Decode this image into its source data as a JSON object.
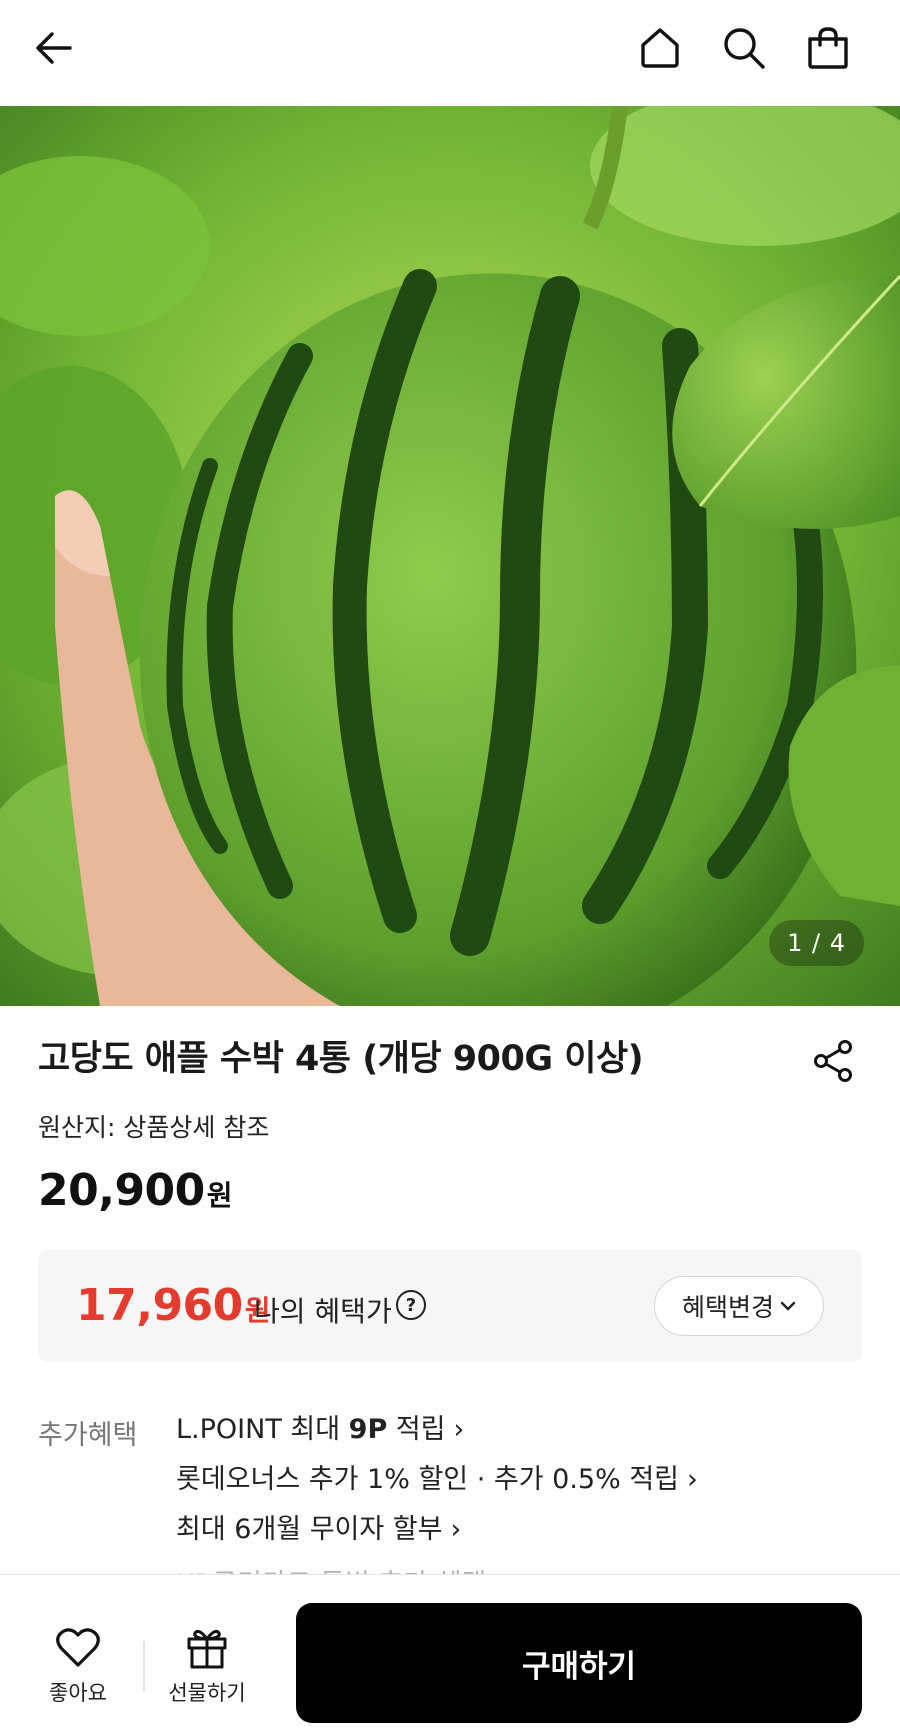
{
  "header": {
    "back_icon": "arrow-left-icon",
    "home_icon": "home-icon",
    "search_icon": "search-icon",
    "cart_icon": "shopping-bag-icon"
  },
  "gallery": {
    "pager": "1 / 4",
    "current": 1,
    "total": 4
  },
  "product": {
    "title": "고당도 애플 수박 4통 (개당 900G 이상)",
    "origin": "원산지: 상품상세 참조",
    "price": "20,900",
    "price_unit": "원"
  },
  "benefit": {
    "price": "17,960",
    "price_unit": "원",
    "label": "나의 혜택가",
    "help_glyph": "?",
    "change_button": "혜택변경",
    "price_color": "#e33b2e"
  },
  "extra": {
    "label": "추가혜택",
    "items": [
      {
        "prefix": "L.POINT 최대 ",
        "bold": "9P",
        "suffix": " 적립"
      },
      {
        "prefix": "롯데오너스 추가 1% 할인 · 추가 0.5% 적립",
        "bold": "",
        "suffix": ""
      },
      {
        "prefix": "최대 6개월 무이자 할부",
        "bold": "",
        "suffix": ""
      }
    ],
    "cut_off_item": "KB국민카드 특별 추가 혜택"
  },
  "bottom_bar": {
    "like_label": "좋아요",
    "gift_label": "선물하기",
    "buy_label": "구매하기"
  }
}
